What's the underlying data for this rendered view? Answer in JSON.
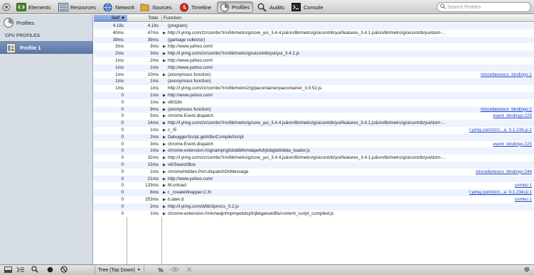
{
  "toolbar": {
    "panels": [
      {
        "label": "Elements",
        "icon": "elements-icon"
      },
      {
        "label": "Resources",
        "icon": "resources-icon"
      },
      {
        "label": "Network",
        "icon": "network-icon"
      },
      {
        "label": "Sources",
        "icon": "sources-icon"
      },
      {
        "label": "Timeline",
        "icon": "timeline-icon"
      },
      {
        "label": "Profiles",
        "icon": "profiles-icon",
        "selected": true
      },
      {
        "label": "Audits",
        "icon": "audits-icon"
      },
      {
        "label": "Console",
        "icon": "console-icon"
      }
    ],
    "search_placeholder": "Search Profiles"
  },
  "sidebar": {
    "title": "Profiles",
    "section": "CPU PROFILES",
    "profile_label": "Profile 1"
  },
  "grid": {
    "columns": {
      "self": "Self",
      "total": "Total",
      "function": "Function"
    },
    "rows": [
      {
        "self": "4.18s",
        "total": "4.18s",
        "expand": false,
        "func": "(program)",
        "link": ""
      },
      {
        "self": "40ms",
        "total": "47ms",
        "expand": true,
        "func": "http://l.yimg.com/zz/combo?nn/lib/metro/g/core_yui_3.4.4.js&nn/lib/metro/g/uicontrib/yui/features_3.4.1.js&nn/lib/metro/g/uicontrib/yui/dom-...",
        "link": ""
      },
      {
        "self": "39ms",
        "total": "39ms",
        "expand": false,
        "func": "(garbage collector)",
        "link": ""
      },
      {
        "self": "3ms",
        "total": "3ms",
        "expand": true,
        "func": "http://www.yahoo.com/",
        "link": ""
      },
      {
        "self": "2ms",
        "total": "3ms",
        "expand": true,
        "func": "http://l.yimg.com/zz/combo?nn/lib/metro/g/uicontrib/yui/yui_3.4.2.js",
        "link": ""
      },
      {
        "self": "1ms",
        "total": "2ms",
        "expand": true,
        "func": "http://www.yahoo.com/",
        "link": ""
      },
      {
        "self": "1ms",
        "total": "1ms",
        "expand": false,
        "func": "http://www.yahoo.com/",
        "link": ""
      },
      {
        "self": "1ms",
        "total": "10ms",
        "expand": true,
        "func": "(anonymous function)",
        "link": "miscellaneous_bindings:1"
      },
      {
        "self": "1ms",
        "total": "1ms",
        "expand": false,
        "func": "(anonymous function)",
        "link": ""
      },
      {
        "self": "1ms",
        "total": "1ms",
        "expand": false,
        "func": "http://l.yimg.com/zz/combo?nn/lib/metro2/g/pacontainer/pacontainer_0.0.52.js",
        "link": ""
      },
      {
        "self": "0",
        "total": "1ms",
        "expand": true,
        "func": "http://www.yahoo.com/",
        "link": ""
      },
      {
        "self": "0",
        "total": "1ms",
        "expand": true,
        "func": "v8/i18n",
        "link": ""
      },
      {
        "self": "0",
        "total": "9ms",
        "expand": true,
        "func": "(anonymous function)",
        "link": "miscellaneous_bindings:1"
      },
      {
        "self": "0",
        "total": "5ms",
        "expand": true,
        "func": "chrome.Event.dispatch",
        "link": "event_bindings:225"
      },
      {
        "self": "0",
        "total": "14ms",
        "expand": true,
        "func": "http://l.yimg.com/zz/combo?nn/lib/metro/g/core_yui_3.4.4.js&nn/lib/metro/g/uicontrib/yui/features_3.4.1.js&nn/lib/metro/g/uicontrib/yui/dom-...",
        "link": ""
      },
      {
        "self": "0",
        "total": "1ms",
        "expand": true,
        "func": "c_r5",
        "link": "l.yimg.com/zz/c...a_0.1.234.js:1"
      },
      {
        "self": "0",
        "total": "2ms",
        "expand": true,
        "func": "DebuggerScript.getAfterCompileScript",
        "link": ""
      },
      {
        "self": "0",
        "total": "3ms",
        "expand": true,
        "func": "chrome.Event.dispatch",
        "link": "event_bindings:225"
      },
      {
        "self": "0",
        "total": "1ms",
        "expand": true,
        "func": "chrome-extension://ognampngfcbddbfemdapefohjiobgbdl/data_loader.js",
        "link": ""
      },
      {
        "self": "0",
        "total": "32ms",
        "expand": true,
        "func": "http://l.yimg.com/zz/combo?nn/lib/metro/g/core_yui_3.4.4.js&nn/lib/metro/g/uicontrib/yui/features_3.4.1.js&nn/lib/metro/g/uicontrib/yui/dom-...",
        "link": ""
      },
      {
        "self": "0",
        "total": "15ms",
        "expand": true,
        "func": "v8/SearchBox",
        "link": ""
      },
      {
        "self": "0",
        "total": "1ms",
        "expand": true,
        "func": "chromeHidden.Port.dispatchOnMessage",
        "link": "miscellaneous_bindings:244"
      },
      {
        "self": "0",
        "total": "21ms",
        "expand": true,
        "func": "http://www.yahoo.com/",
        "link": ""
      },
      {
        "self": "0",
        "total": "133ms",
        "expand": true,
        "func": "M.onload",
        "link": "combo:1"
      },
      {
        "self": "0",
        "total": "8ms",
        "expand": true,
        "func": "r._createWrapper.C.fn",
        "link": "l.yimg.com/zz/c...a_0.1.234.js:1"
      },
      {
        "self": "0",
        "total": "253ms",
        "expand": true,
        "func": "b.later.d",
        "link": "combo:1"
      },
      {
        "self": "0",
        "total": "2ms",
        "expand": true,
        "func": "http://l.yimg.com/d/lib/3pm/cs_0.2.js",
        "link": ""
      },
      {
        "self": "0",
        "total": "1ms",
        "expand": true,
        "func": "chrome-extension://mkmaajnfmpmpebdcpfnjbkgaloeidlfa/content_script_compiled.js",
        "link": ""
      }
    ]
  },
  "statusbar": {
    "view_mode": "Tree (Top Down)",
    "percent_toggle": "%"
  }
}
